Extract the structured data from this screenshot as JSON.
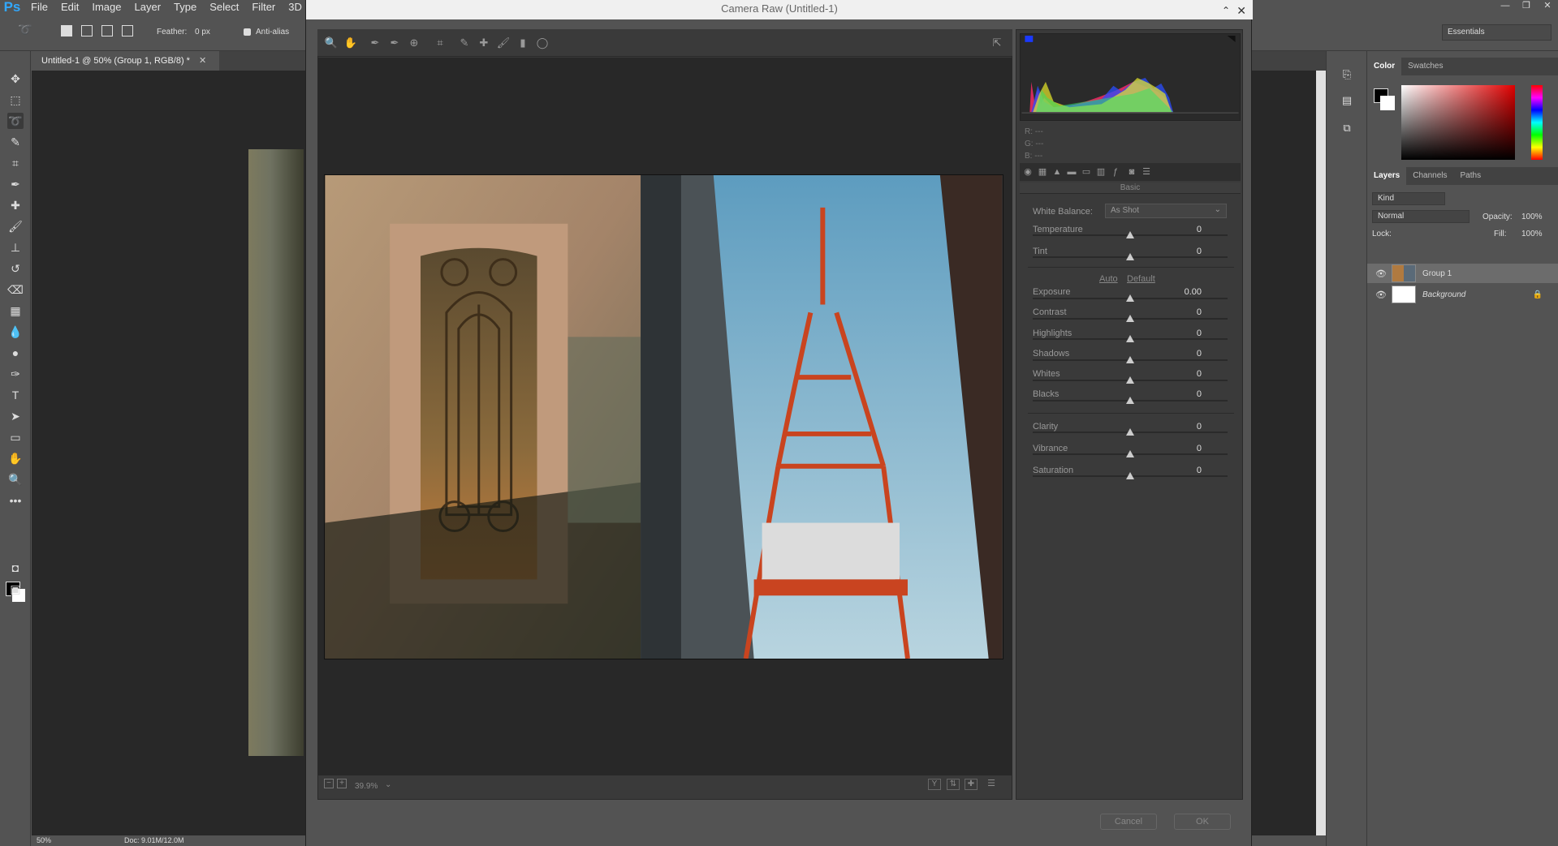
{
  "photoshop": {
    "logo": "Ps",
    "menus": [
      "File",
      "Edit",
      "Image",
      "Layer",
      "Type",
      "Select",
      "Filter",
      "3D"
    ],
    "options": {
      "feather_label": "Feather:",
      "feather_value": "0 px",
      "antialias_label": "Anti-alias",
      "workspace": "Essentials"
    },
    "document_tab": "Untitled-1 @ 50% (Group 1, RGB/8) *",
    "status": {
      "zoom": "50%",
      "doc": "Doc: 9.01M/12.0M"
    }
  },
  "panels": {
    "color_tabs": [
      "Color",
      "Swatches"
    ],
    "layers_tabs": [
      "Layers",
      "Channels",
      "Paths"
    ],
    "kind_filter": "Kind",
    "blend_mode": "Normal",
    "opacity_label": "Opacity:",
    "opacity_value": "100%",
    "lock_label": "Lock:",
    "fill_label": "Fill:",
    "fill_value": "100%",
    "layers": [
      {
        "name": "Group 1"
      },
      {
        "name": "Background"
      }
    ]
  },
  "camera_raw": {
    "title": "Camera Raw (Untitled-1)",
    "readout": {
      "r": "R:  ---",
      "g": "G:  ---",
      "b": "B:  ---"
    },
    "panel_title": "Basic",
    "white_balance_label": "White Balance:",
    "white_balance_value": "As Shot",
    "auto_link": "Auto",
    "default_link": "Default",
    "sliders": [
      {
        "label": "Temperature",
        "value": "0"
      },
      {
        "label": "Tint",
        "value": "0"
      },
      {
        "label": "Exposure",
        "value": "0.00"
      },
      {
        "label": "Contrast",
        "value": "0"
      },
      {
        "label": "Highlights",
        "value": "0"
      },
      {
        "label": "Shadows",
        "value": "0"
      },
      {
        "label": "Whites",
        "value": "0"
      },
      {
        "label": "Blacks",
        "value": "0"
      },
      {
        "label": "Clarity",
        "value": "0"
      },
      {
        "label": "Vibrance",
        "value": "0"
      },
      {
        "label": "Saturation",
        "value": "0"
      }
    ],
    "zoom_value": "39.9%",
    "cancel_label": "Cancel",
    "ok_label": "OK"
  },
  "colors": {
    "ps_blue": "#31a8ff",
    "dialog_bg": "#535353",
    "preview_bg": "#282828"
  }
}
